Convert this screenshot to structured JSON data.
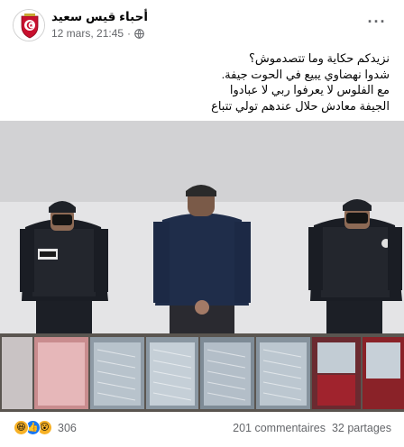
{
  "post": {
    "page_name": "أحباء قيس سعيد",
    "timestamp": "12 mars, 21:45",
    "separator": "·",
    "more_label": "···",
    "text_lines": [
      "نزيدكم حكاية وما تتصدموش؟",
      "شدوا نهضاوي يبيع في الحوت جيفة.",
      "مع الفلوس لا يعرفوا ربي لا عبادوا",
      "الجيفة معادش حلال عندهم تولي تتباع"
    ],
    "photo_icon": "police-with-fish-crates-photo"
  },
  "footer": {
    "reaction_icons": [
      "haha-icon",
      "like-icon",
      "wow-icon"
    ],
    "reaction_count": "306",
    "comments": "201 commentaires",
    "shares": "32 partages"
  },
  "colors": {
    "brand_blue": "#1877f2",
    "secondary_text": "#65676b",
    "emblem_red": "#c8102e"
  }
}
